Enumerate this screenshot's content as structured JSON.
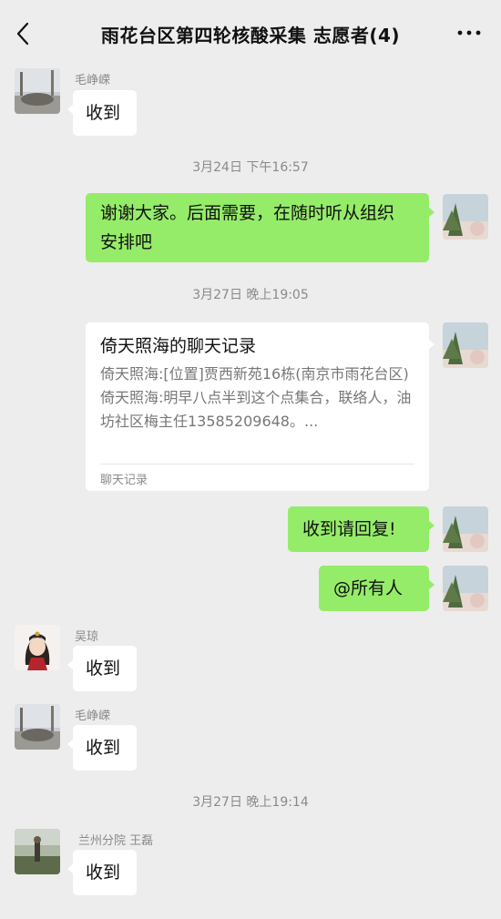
{
  "header": {
    "title": "雨花台区第四轮核酸采集 志愿者(4)"
  },
  "messages": {
    "m1": {
      "sender": "毛峥嵘",
      "text": "收到"
    },
    "ts1": "3月24日 下午16:57",
    "m2": {
      "line1": "谢谢大家。后面需要，在随时听从组织",
      "line2": "安排吧"
    },
    "ts2": "3月27日 晚上19:05",
    "card": {
      "title": "倚天照海的聊天记录",
      "line1": "倚天照海:[位置]贾西新苑16栋(南京市雨花台区)",
      "line2": "倚天照海:明早八点半到这个点集合，联络人，油坊社区梅主任13585209648。...",
      "footer": "聊天记录"
    },
    "m3": {
      "text": "收到请回复!"
    },
    "m4": {
      "text": "@所有人"
    },
    "m5": {
      "sender": "吴琼",
      "text": "收到"
    },
    "m6": {
      "sender": "毛峥嵘",
      "text": "收到"
    },
    "ts3": "3月27日 晚上19:14",
    "m7": {
      "sender": "兰州分院 王磊",
      "text": "收到"
    }
  },
  "icons": {
    "back": "chevron-left-icon",
    "more": "more-dots-icon"
  },
  "colors": {
    "background": "#ededed",
    "bubble_self": "#95ec69",
    "bubble_other": "#ffffff",
    "meta_text": "#8a8a8a"
  }
}
